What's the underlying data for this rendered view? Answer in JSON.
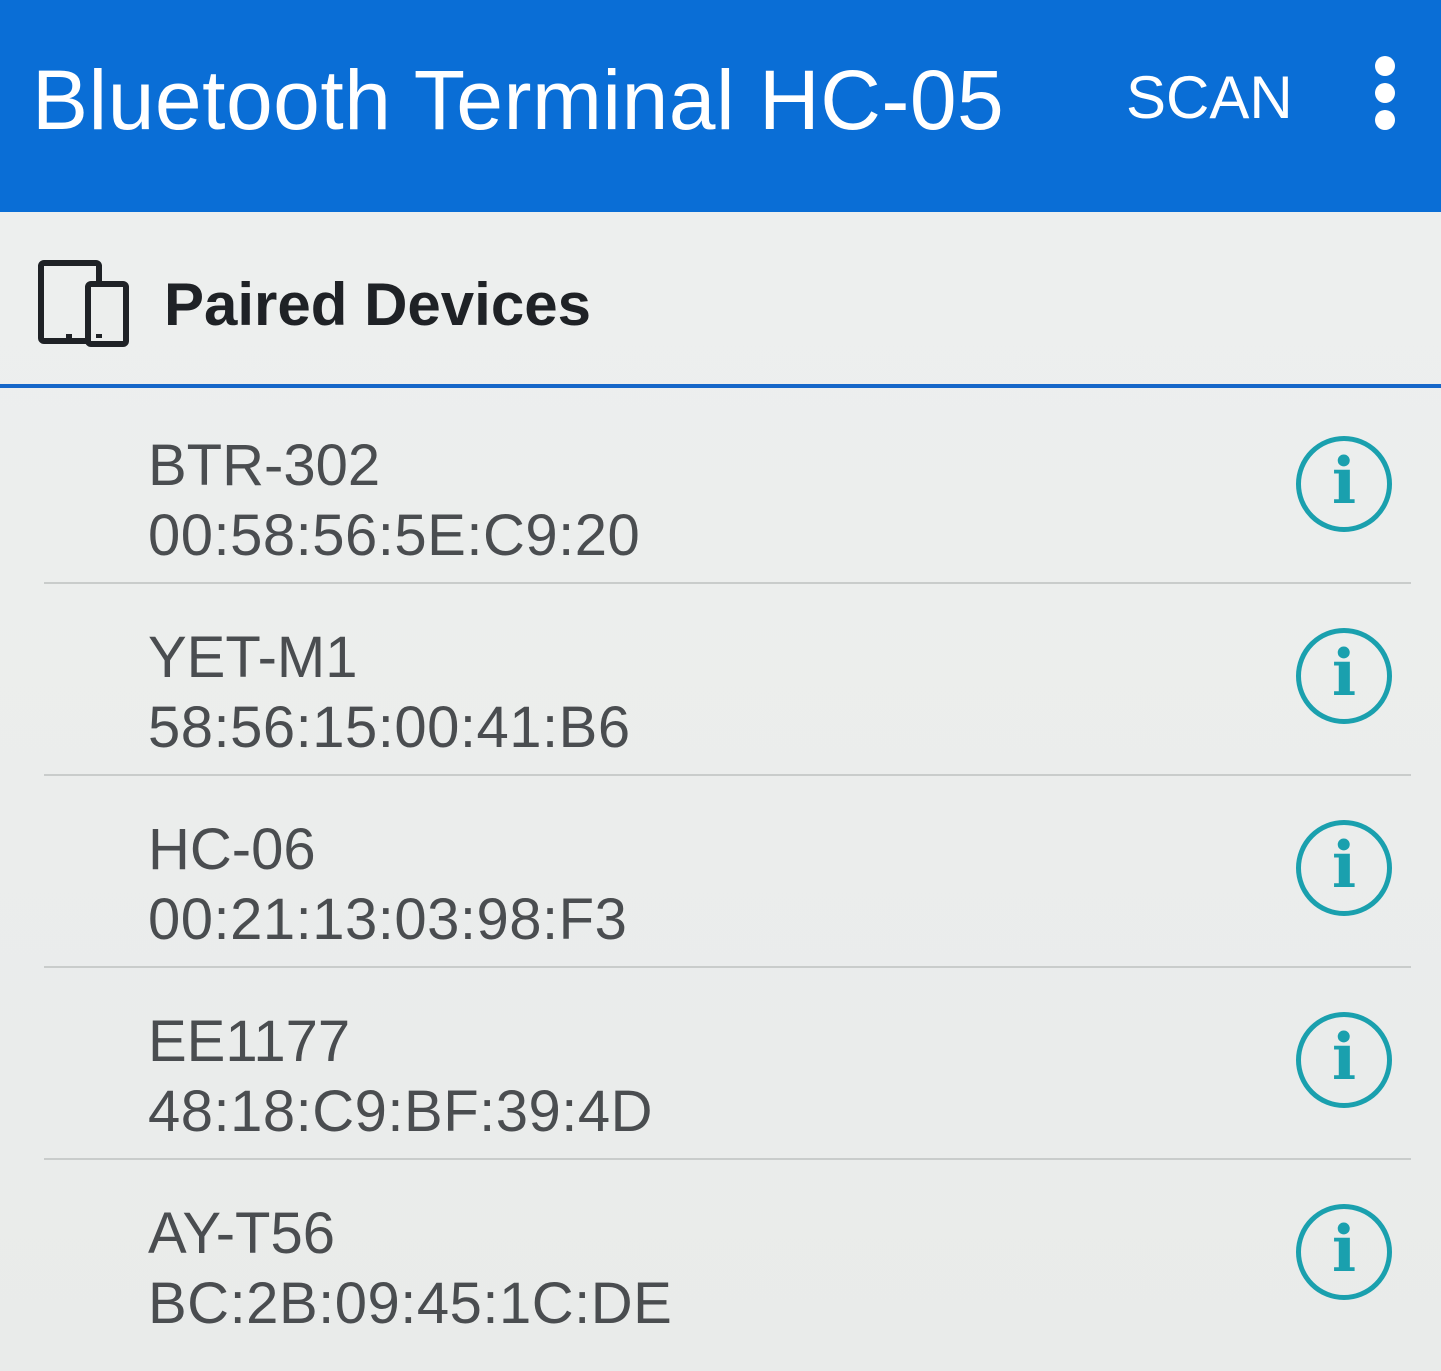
{
  "app_bar": {
    "title": "Bluetooth Terminal HC-05",
    "scan_label": "SCAN",
    "background_color": "#0a6ed6"
  },
  "section": {
    "title": "Paired Devices",
    "icon": "devices-icon",
    "accent_color": "#1667c9"
  },
  "devices": [
    {
      "name": "BTR-302",
      "address": "00:58:56:5E:C9:20"
    },
    {
      "name": "YET-M1",
      "address": "58:56:15:00:41:B6"
    },
    {
      "name": "HC-06",
      "address": "00:21:13:03:98:F3"
    },
    {
      "name": "EE1177",
      "address": "48:18:C9:BF:39:4D"
    },
    {
      "name": "AY-T56",
      "address": "BC:2B:09:45:1C:DE"
    }
  ],
  "info_icon": {
    "glyph": "i",
    "color": "#1aa0ae"
  }
}
